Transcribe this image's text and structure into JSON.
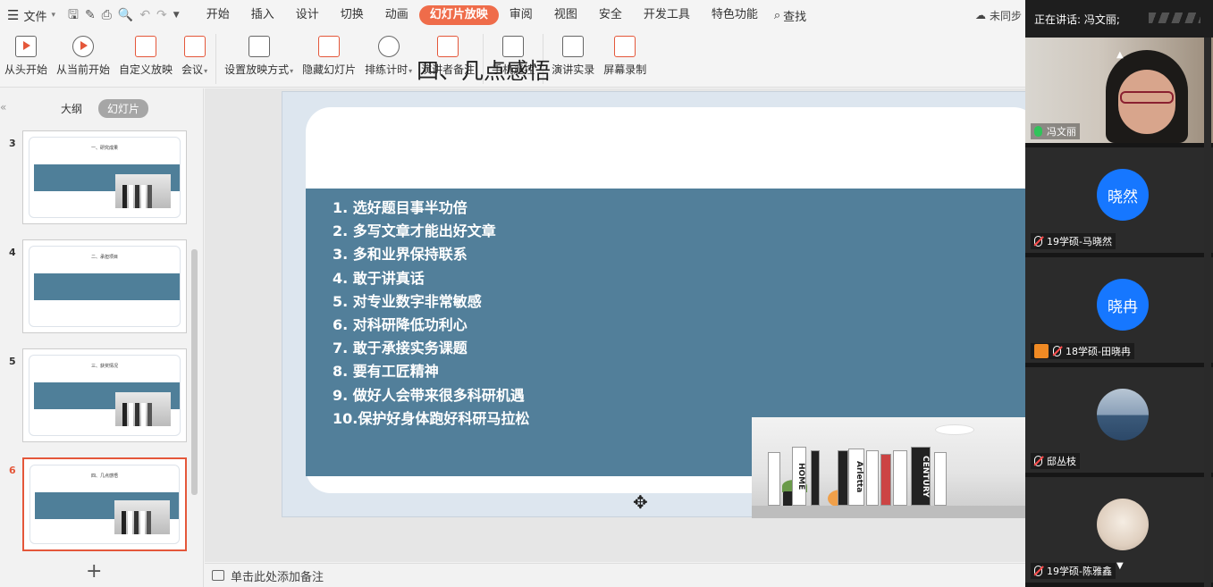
{
  "menubar": {
    "file_label": "文件",
    "tabs": [
      {
        "label": "开始",
        "active": false
      },
      {
        "label": "插入",
        "active": false
      },
      {
        "label": "设计",
        "active": false
      },
      {
        "label": "切换",
        "active": false
      },
      {
        "label": "动画",
        "active": false
      },
      {
        "label": "幻灯片放映",
        "active": true
      },
      {
        "label": "审阅",
        "active": false
      },
      {
        "label": "视图",
        "active": false
      },
      {
        "label": "安全",
        "active": false
      },
      {
        "label": "开发工具",
        "active": false
      },
      {
        "label": "特色功能",
        "active": false
      }
    ],
    "search_label": "查找",
    "sync_label": "未同步",
    "accent_color": "#ef6c4a"
  },
  "ribbon": {
    "buttons": [
      {
        "label": "从头开始"
      },
      {
        "label": "从当前开始"
      },
      {
        "label": "自定义放映"
      },
      {
        "label": "会议"
      },
      {
        "label": "设置放映方式"
      },
      {
        "label": "隐藏幻灯片"
      },
      {
        "label": "排练计时"
      },
      {
        "label": "演讲者备注"
      },
      {
        "label": "手机遥控"
      },
      {
        "label": "演讲实录"
      },
      {
        "label": "屏幕录制"
      }
    ]
  },
  "panel": {
    "tab_outline": "大纲",
    "tab_slides": "幻灯片",
    "thumbnails": [
      {
        "number": "3",
        "title": "一、研究成果",
        "selected": false
      },
      {
        "number": "4",
        "title": "二、承担项目",
        "selected": false
      },
      {
        "number": "5",
        "title": "三、获奖情况",
        "selected": false
      },
      {
        "number": "6",
        "title": "四、几点感悟",
        "selected": true
      }
    ],
    "add_slide": "+"
  },
  "slide": {
    "title": "四、几点感悟",
    "band_color": "#527f9a",
    "items": [
      "1.  选好题目事半功倍",
      "2.  多写文章才能出好文章",
      "3.  多和业界保持联系",
      "4.  敢于讲真话",
      "5.  对专业数字非常敏感",
      "6.  对科研降低功利心",
      "7.  敢于承接实务课题",
      "8.  要有工匠精神",
      "9.  做好人会带来很多科研机遇",
      "10.保护好身体跑好科研马拉松"
    ],
    "book_titles": [
      "HOME",
      "Arletta",
      "CENTURY"
    ]
  },
  "notes": {
    "placeholder": "单击此处添加备注"
  },
  "meeting": {
    "speaking_label": "正在讲话: 冯文丽;",
    "participants": [
      {
        "name": "冯文丽",
        "avatar_text": "",
        "mic": "on"
      },
      {
        "name": "19学硕-马晓然",
        "avatar_text": "晓然",
        "mic": "off"
      },
      {
        "name": "18学硕-田晓冉",
        "avatar_text": "晓冉",
        "mic": "off"
      },
      {
        "name": "邸丛枝",
        "avatar_text": "",
        "mic": "off"
      },
      {
        "name": "19学硕-陈雅鑫",
        "avatar_text": "",
        "mic": "off"
      }
    ]
  }
}
